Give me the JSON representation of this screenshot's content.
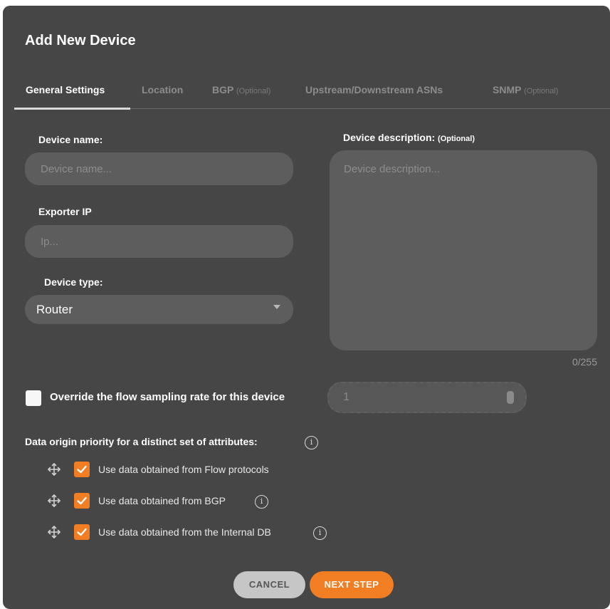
{
  "dialog": {
    "title": "Add New Device",
    "tabs": [
      {
        "label": "General Settings",
        "suffix": ""
      },
      {
        "label": "Location",
        "suffix": ""
      },
      {
        "label": "BGP",
        "suffix": "(Optional)"
      },
      {
        "label": "Upstream/Downstream ASNs",
        "suffix": ""
      },
      {
        "label": "SNMP",
        "suffix": "(Optional)"
      }
    ],
    "active_tab": "General Settings"
  },
  "form": {
    "device_name": {
      "label": "Device name:",
      "placeholder": "Device name...",
      "value": ""
    },
    "exporter_ip": {
      "label": "Exporter IP",
      "placeholder": "Ip...",
      "value": ""
    },
    "device_type": {
      "label": "Device type:",
      "value": "Router"
    },
    "description": {
      "label": "Device description:",
      "label_suffix": "(Optional)",
      "placeholder": "Device description...",
      "counter": "0/255"
    },
    "override": {
      "label": "Override the flow sampling rate for this device",
      "checked": false,
      "rate_value": "1"
    },
    "priority": {
      "label": "Data origin priority for a distinct set of attributes:",
      "options": [
        {
          "label": "Use data obtained from Flow protocols",
          "checked": true
        },
        {
          "label": "Use data obtained from BGP",
          "checked": true
        },
        {
          "label": "Use data obtained from the Internal DB",
          "checked": true
        }
      ]
    }
  },
  "buttons": {
    "cancel": "CANCEL",
    "next": "NEXT STEP"
  },
  "colors": {
    "accent": "#f27e23",
    "dialog_bg": "#464646",
    "input_bg": "#5d5d5d"
  }
}
